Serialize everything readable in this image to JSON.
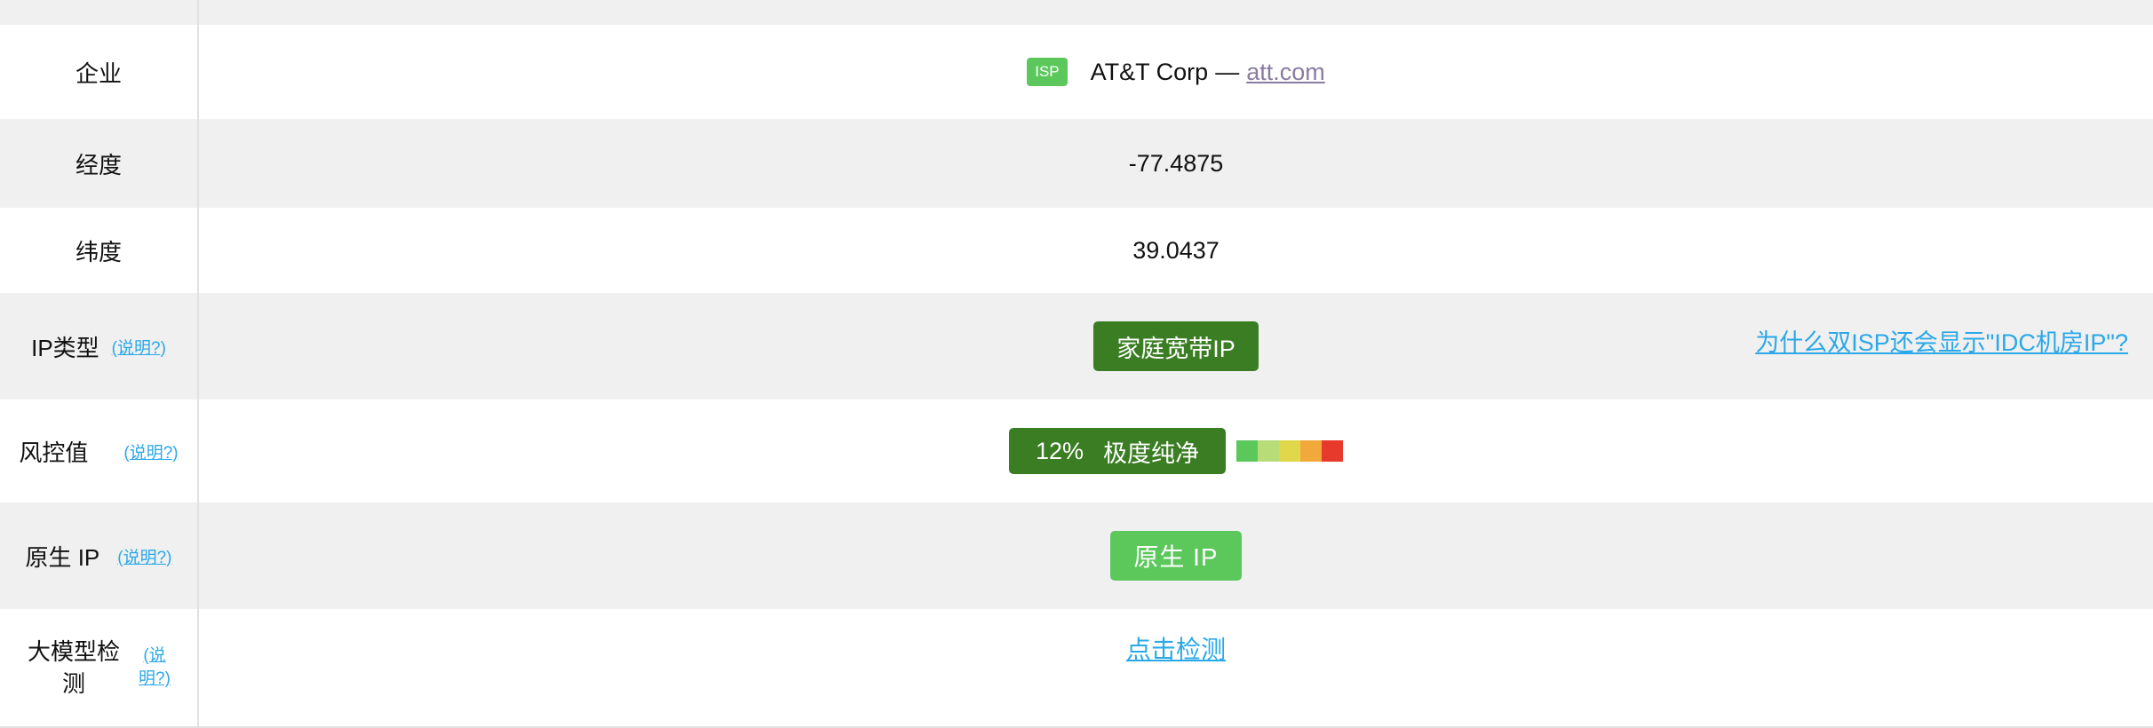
{
  "rows": {
    "company": {
      "label": "企业",
      "badge": "ISP",
      "name": "AT&T Corp",
      "separator": "—",
      "domain": "att.com"
    },
    "longitude": {
      "label": "经度",
      "value": "-77.4875"
    },
    "latitude": {
      "label": "纬度",
      "value": "39.0437"
    },
    "ip_type": {
      "label": "IP类型",
      "explain": "(说明?)",
      "value": "家庭宽带IP",
      "right_link": "为什么双ISP还会显示\"IDC机房IP\"?"
    },
    "risk": {
      "label": "风控值",
      "explain": "(说明?)",
      "value": "12%",
      "level": "极度纯净",
      "meter_colors": [
        "#5cc85c",
        "#b8dc78",
        "#e0d84a",
        "#f2a93b",
        "#e83a2c"
      ]
    },
    "native_ip": {
      "label": "原生 IP",
      "explain": "(说明?)",
      "value": "原生 IP"
    },
    "llm_detect": {
      "label": "大模型检测",
      "explain": "(说明?)",
      "link": "点击检测"
    }
  },
  "colors": {
    "row_gray": "#f0f0f0",
    "badge_dark_green": "#3a7d23",
    "badge_light_green": "#5cc85c",
    "link_blue": "#2aa8e8",
    "link_gray": "#8a7ba0"
  }
}
